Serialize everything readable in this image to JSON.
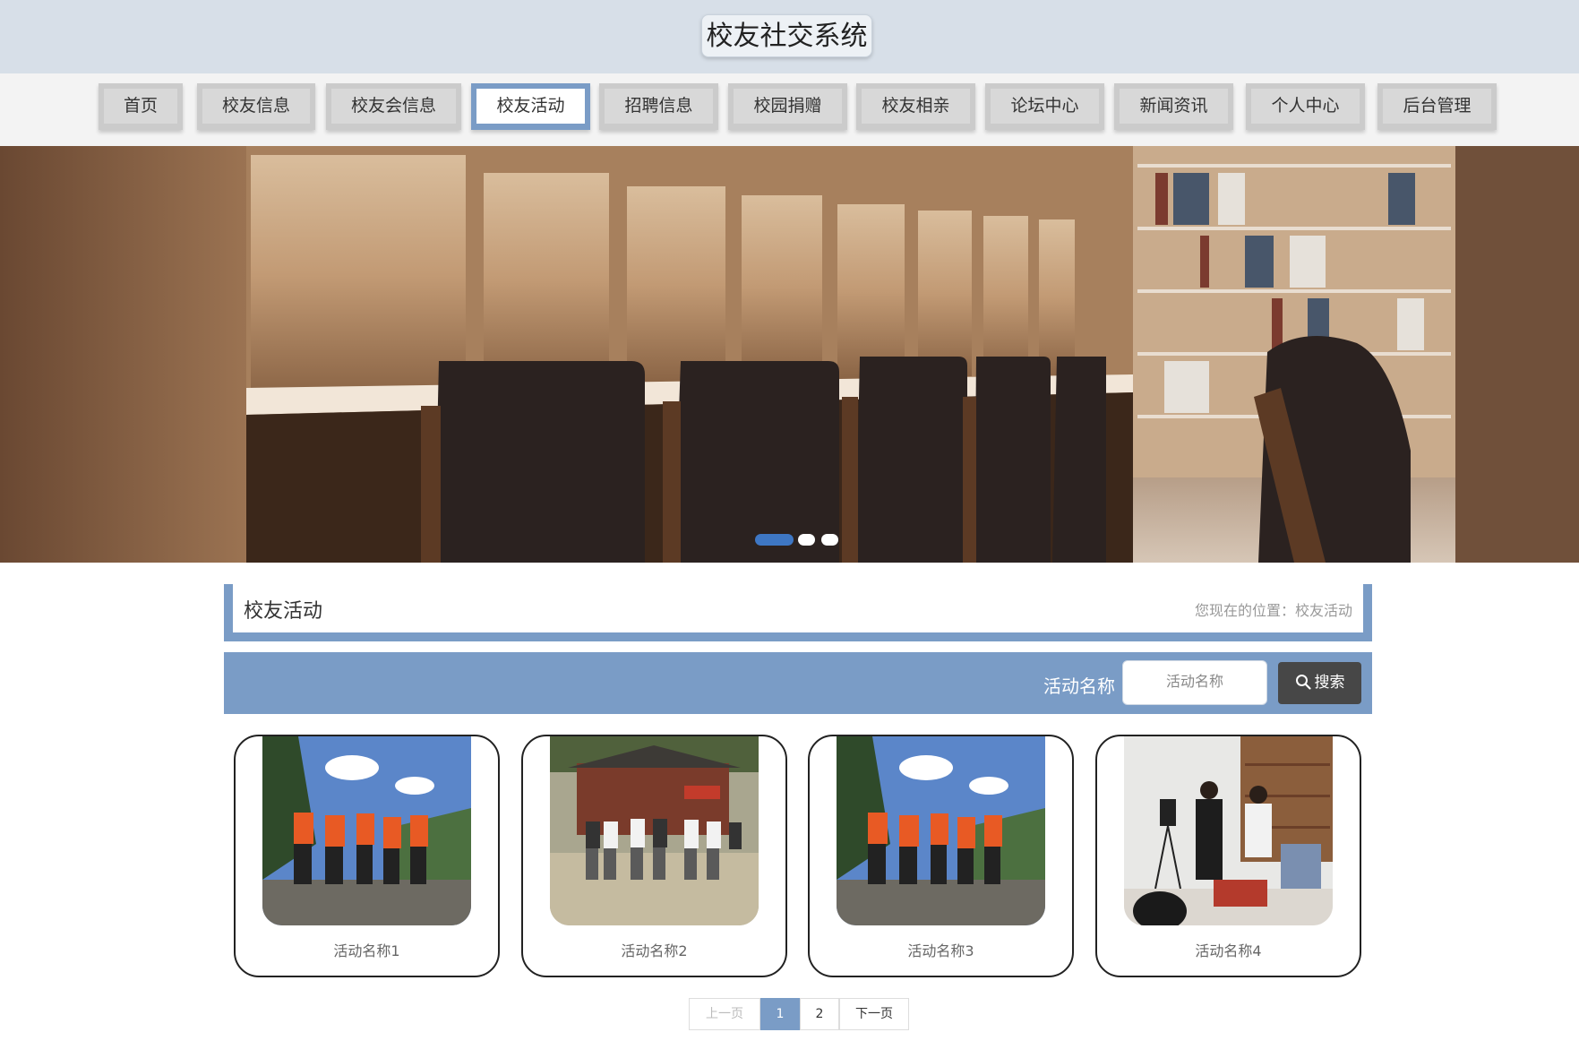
{
  "header": {
    "title": "校友社交系统"
  },
  "nav": {
    "items": [
      {
        "label": "首页"
      },
      {
        "label": "校友信息"
      },
      {
        "label": "校友会信息"
      },
      {
        "label": "校友活动",
        "active": true
      },
      {
        "label": "招聘信息"
      },
      {
        "label": "校园捐赠"
      },
      {
        "label": "校友相亲"
      },
      {
        "label": "论坛中心"
      },
      {
        "label": "新闻资讯"
      },
      {
        "label": "个人中心"
      },
      {
        "label": "后台管理"
      }
    ]
  },
  "banner": {
    "slide_count": 3,
    "active_slide": 1
  },
  "section": {
    "title": "校友活动",
    "breadcrumb": "您现在的位置：校友活动"
  },
  "search": {
    "label": "活动名称",
    "placeholder": "活动名称",
    "button_label": "搜索"
  },
  "cards": [
    {
      "name": "活动名称1"
    },
    {
      "name": "活动名称2"
    },
    {
      "name": "活动名称3"
    },
    {
      "name": "活动名称4"
    }
  ],
  "pagination": {
    "prev_label": "上一页",
    "pages": [
      "1",
      "2"
    ],
    "current": "1",
    "next_label": "下一页"
  },
  "colors": {
    "accent": "#7a9cc6",
    "header_bg": "#d7dfe8",
    "search_button": "#474747"
  }
}
